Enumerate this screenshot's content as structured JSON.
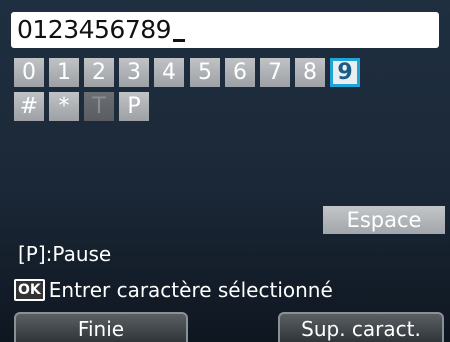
{
  "entry": {
    "value": "0123456789"
  },
  "keys": {
    "row1": [
      "0",
      "1",
      "2",
      "3",
      "4",
      "5",
      "6",
      "7",
      "8",
      "9"
    ],
    "row2": [
      "#",
      "*",
      "T",
      "P"
    ],
    "selected": "9",
    "disabled": "T"
  },
  "space_label": "Espace",
  "hints": {
    "pause": "[P]:Pause",
    "ok_icon": "OK",
    "ok_action": "Entrer caractère sélectionné"
  },
  "softkeys": {
    "left": "Finie",
    "right": "Sup. caract."
  }
}
